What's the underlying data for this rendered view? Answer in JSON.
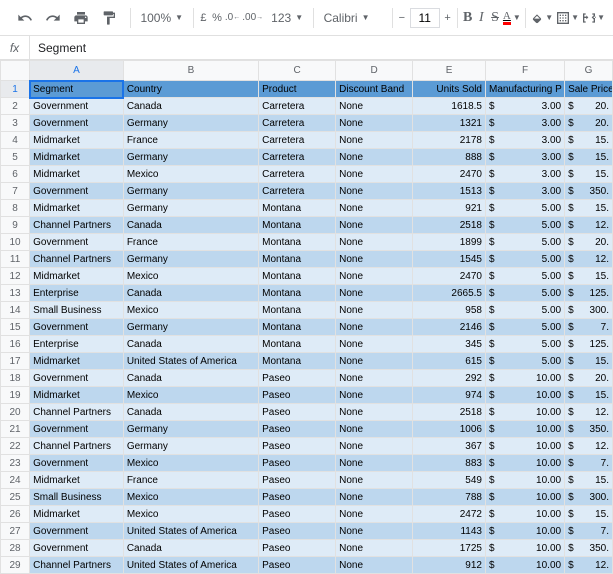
{
  "toolbar": {
    "zoom": "100%",
    "currency_btn": "£",
    "percent_btn": "%",
    "dec_dec": ".0",
    "inc_dec": ".00",
    "format_menu": "123",
    "font": "Calibri",
    "font_size": "11",
    "bold": "B",
    "italic": "I",
    "strike": "S",
    "text_color": "A"
  },
  "formula_bar": {
    "fx": "fx",
    "value": "Segment"
  },
  "columns": [
    "A",
    "B",
    "C",
    "D",
    "E",
    "F",
    "G"
  ],
  "headers": [
    "Segment",
    "Country",
    "Product",
    "Discount Band",
    "Units Sold",
    "Manufacturing P",
    "Sale Price"
  ],
  "rows": [
    [
      "Government",
      "Canada",
      "Carretera",
      "None",
      "1618.5",
      "3.00",
      "20."
    ],
    [
      "Government",
      "Germany",
      "Carretera",
      "None",
      "1321",
      "3.00",
      "20."
    ],
    [
      "Midmarket",
      "France",
      "Carretera",
      "None",
      "2178",
      "3.00",
      "15."
    ],
    [
      "Midmarket",
      "Germany",
      "Carretera",
      "None",
      "888",
      "3.00",
      "15."
    ],
    [
      "Midmarket",
      "Mexico",
      "Carretera",
      "None",
      "2470",
      "3.00",
      "15."
    ],
    [
      "Government",
      "Germany",
      "Carretera",
      "None",
      "1513",
      "3.00",
      "350."
    ],
    [
      "Midmarket",
      "Germany",
      "Montana",
      "None",
      "921",
      "5.00",
      "15."
    ],
    [
      "Channel Partners",
      "Canada",
      "Montana",
      "None",
      "2518",
      "5.00",
      "12."
    ],
    [
      "Government",
      "France",
      "Montana",
      "None",
      "1899",
      "5.00",
      "20."
    ],
    [
      "Channel Partners",
      "Germany",
      "Montana",
      "None",
      "1545",
      "5.00",
      "12."
    ],
    [
      "Midmarket",
      "Mexico",
      "Montana",
      "None",
      "2470",
      "5.00",
      "15."
    ],
    [
      "Enterprise",
      "Canada",
      "Montana",
      "None",
      "2665.5",
      "5.00",
      "125."
    ],
    [
      "Small Business",
      "Mexico",
      "Montana",
      "None",
      "958",
      "5.00",
      "300."
    ],
    [
      "Government",
      "Germany",
      "Montana",
      "None",
      "2146",
      "5.00",
      "7."
    ],
    [
      "Enterprise",
      "Canada",
      "Montana",
      "None",
      "345",
      "5.00",
      "125."
    ],
    [
      "Midmarket",
      "United States of America",
      "Montana",
      "None",
      "615",
      "5.00",
      "15."
    ],
    [
      "Government",
      "Canada",
      "Paseo",
      "None",
      "292",
      "10.00",
      "20."
    ],
    [
      "Midmarket",
      "Mexico",
      "Paseo",
      "None",
      "974",
      "10.00",
      "15."
    ],
    [
      "Channel Partners",
      "Canada",
      "Paseo",
      "None",
      "2518",
      "10.00",
      "12."
    ],
    [
      "Government",
      "Germany",
      "Paseo",
      "None",
      "1006",
      "10.00",
      "350."
    ],
    [
      "Channel Partners",
      "Germany",
      "Paseo",
      "None",
      "367",
      "10.00",
      "12."
    ],
    [
      "Government",
      "Mexico",
      "Paseo",
      "None",
      "883",
      "10.00",
      "7."
    ],
    [
      "Midmarket",
      "France",
      "Paseo",
      "None",
      "549",
      "10.00",
      "15."
    ],
    [
      "Small Business",
      "Mexico",
      "Paseo",
      "None",
      "788",
      "10.00",
      "300."
    ],
    [
      "Midmarket",
      "Mexico",
      "Paseo",
      "None",
      "2472",
      "10.00",
      "15."
    ],
    [
      "Government",
      "United States of America",
      "Paseo",
      "None",
      "1143",
      "10.00",
      "7."
    ],
    [
      "Government",
      "Canada",
      "Paseo",
      "None",
      "1725",
      "10.00",
      "350."
    ],
    [
      "Channel Partners",
      "United States of America",
      "Paseo",
      "None",
      "912",
      "10.00",
      "12."
    ]
  ]
}
